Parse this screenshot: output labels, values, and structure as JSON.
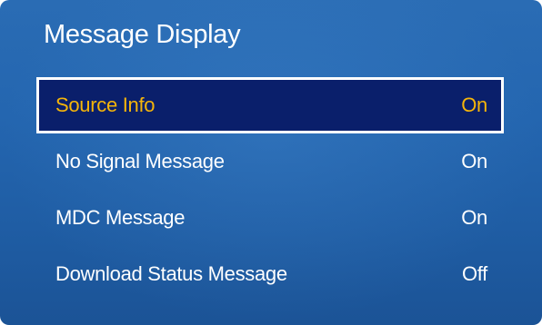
{
  "panel": {
    "title": "Message Display"
  },
  "menu": {
    "items": [
      {
        "label": "Source Info",
        "value": "On",
        "selected": true
      },
      {
        "label": "No Signal Message",
        "value": "On",
        "selected": false
      },
      {
        "label": "MDC Message",
        "value": "On",
        "selected": false
      },
      {
        "label": "Download Status Message",
        "value": "Off",
        "selected": false
      }
    ]
  },
  "colors": {
    "panel_background": "#2466b0",
    "selected_background": "#0a1f6b",
    "selected_text": "#f5b50a",
    "text": "#ffffff",
    "selected_border": "#ffffff"
  }
}
